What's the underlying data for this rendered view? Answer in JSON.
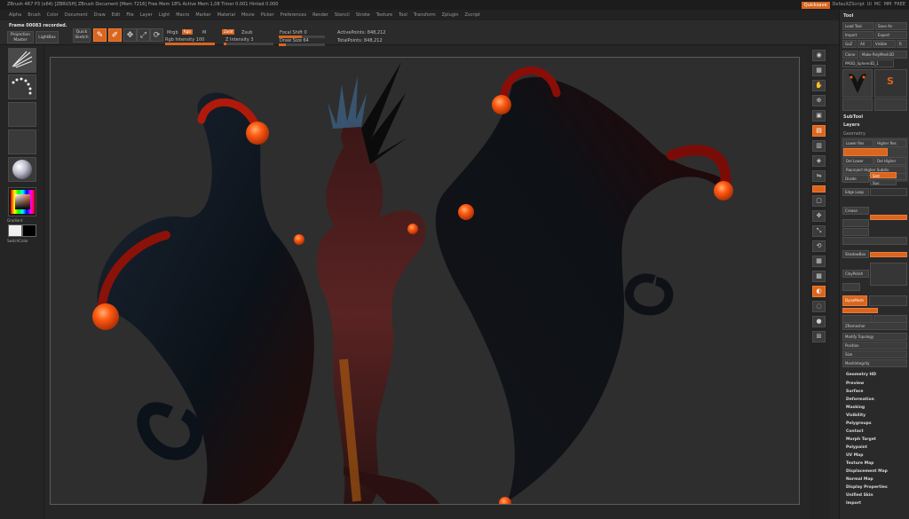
{
  "app": {
    "title": "ZBrush 4R7 P3 (x64) [ZBRUSH] ZBrush Document [Mem 7216] Free Mem 18% Active Mem 1,08 Timer 0.001 Hinted 0.000"
  },
  "header_right": {
    "quicksave": "Quicksave",
    "script": "DefaultZScript",
    "items": [
      "UI",
      "MC",
      "MM",
      "FREE"
    ]
  },
  "menu": [
    "Alpha",
    "Brush",
    "Color",
    "Document",
    "Draw",
    "Edit",
    "File",
    "Layer",
    "Light",
    "Macro",
    "Marker",
    "Material",
    "Movie",
    "Picker",
    "Preferences",
    "Render",
    "Stencil",
    "Stroke",
    "Texture",
    "Tool",
    "Transform",
    "Zplugin",
    "Zscript"
  ],
  "toolbar": {
    "frame_label": "Frame 00083 recorded.",
    "projection_master": "Projection Master",
    "lightbox": "LightBox",
    "quick_sketch": "Quick Sketch",
    "edit": "Edit",
    "draw": "Draw",
    "move": "Move",
    "scale": "Scale",
    "rotate": "Rotate",
    "mrgb": "Mrgb",
    "rgb": "Rgb",
    "m": "M",
    "zadd": "Zadd",
    "zsub": "Zsub",
    "rgb_intensity": "Rgb Intensity 100",
    "z_intensity": "Z Intensity 3",
    "focal_shift": "Focal Shift 0",
    "draw_size": "Draw Size 64",
    "active_points": "ActivePoints: 848,212",
    "total_points": "TotalPoints: 848,212"
  },
  "left_tray": {
    "gradient": "Gradient",
    "switch_color": "SwitchColor"
  },
  "right_tray": {
    "buttons": [
      "BPR",
      "SPix",
      "Scroll",
      "Zoom",
      "Actual",
      "AAHalf",
      "Dynamic",
      "Persp",
      "Floor",
      "Local",
      "LSym",
      "Frame",
      "Move",
      "Scale",
      "Rotate",
      "Line Fill",
      "PolyF",
      "Transp",
      "Ghost",
      "Solo",
      "Xpose"
    ]
  },
  "tool_panel": {
    "header": "Tool",
    "load_tool": "Load Tool",
    "save_as": "Save As",
    "import": "Import",
    "export": "Export",
    "goz": "GoZ",
    "all": "All",
    "visible": "Visible",
    "r": "R",
    "clone": "Clone",
    "make_polymesh": "Make PolyMesh3D",
    "tool_name": "PM3D_Sphere3D_1",
    "subtool": "SubTool",
    "layers": "Layers",
    "geometry_label": "Geometry",
    "lower_res": "Lower Res",
    "higher_res": "Higher Res",
    "del_lower": "Del Lower",
    "del_higher": "Del Higher",
    "reproject": "Reproject Higher Subdiv",
    "convert_bpr": "Convert BPR To Geo",
    "divide": "Divide",
    "smt": "Smt",
    "suv": "Suv",
    "edge_loop": "Edge Loop",
    "crease": "Crease",
    "shadowbox": "ShadowBox",
    "claypolish": "ClayPolish",
    "dynamesh": "DynaMesh",
    "zremesher": "ZRemesher",
    "modify_topology": "Modify Topology",
    "position": "Position",
    "size": "Size",
    "meshintegrity": "MeshIntegrity",
    "sections": [
      "Geometry HD",
      "Preview",
      "Surface",
      "Deformation",
      "Masking",
      "Visibility",
      "Polygroups",
      "Contact",
      "Morph Target",
      "Polypaint",
      "UV Map",
      "Texture Map",
      "Displacement Map",
      "Normal Map",
      "Display Properties",
      "Unified Skin",
      "Import"
    ]
  },
  "colors": {
    "accent": "#d9651f",
    "panel": "#2a2a2a",
    "canvas": "#2e2e2e",
    "model_dark": "#0d1218",
    "sphere_orange": "#ff5a12"
  }
}
